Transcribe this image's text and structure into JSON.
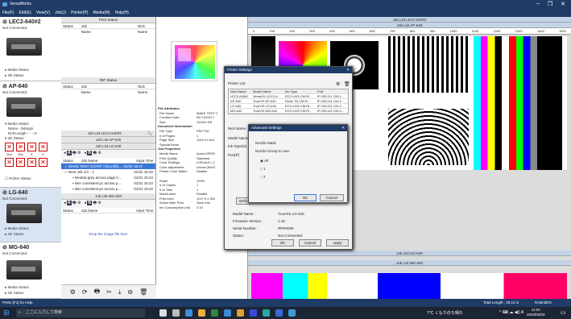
{
  "window": {
    "title": "VersaWorks",
    "min": "–",
    "max": "❐",
    "close": "✕"
  },
  "menu": [
    "File(F)",
    "Edit(E)",
    "View(V)",
    "Job(J)",
    "Printer(P)",
    "Media(M)",
    "Help(H)"
  ],
  "printers": [
    {
      "name": "LEC2-640#2",
      "status": "Not Connected.",
      "links": [
        "Media Status",
        "Ink Status"
      ]
    },
    {
      "name": "AP-640",
      "status": "Not Connected.",
      "links": [
        "Media Status",
        "Name - (Margin",
        "Roll Length - - - m",
        "Ink Status"
      ]
    },
    {
      "name": "LG-640",
      "status": "Not Connected.",
      "links": [
        "Media Status",
        "Ink Status"
      ]
    },
    {
      "name": "MG-640",
      "status": "Not Connected.",
      "links": [
        "Media Status",
        "Ink Status"
      ]
    }
  ],
  "ink_labels": [
    "Dot",
    "Dot",
    "K",
    "C"
  ],
  "printer_status": "Printer Status",
  "print_status": {
    "header": "Print Status",
    "cols": [
      "Status",
      "Job Name",
      "Nick Name"
    ]
  },
  "rip_status": {
    "header": "RIP Status",
    "cols": [
      "Status",
      "Job Name",
      "Nick Name"
    ]
  },
  "joblists": {
    "lec2": "Job List LEC2-640#2",
    "ap": "Job List AP-640",
    "lg": "Job List LG-640",
    "mg": "Job List MG-640",
    "ug": "Job List UG-640"
  },
  "queue": {
    "label": "A",
    "name": "B",
    "cols": [
      "Status",
      "Job Name",
      "Input Time"
    ],
    "jobs": [
      {
        "name": "MAKE TEST CHART rose.pdf(L...",
        "time": "01/31 15:47"
      },
      {
        "name": "Nest Job 1/1 - 1",
        "time": "01/31 15:22"
      },
      {
        "name": "Neutral grey across page.C...",
        "time": "01/31 15:22"
      },
      {
        "name": "skin consistency1 across p...",
        "time": "01/31 15:22"
      },
      {
        "name": "skin consistency2 across p...",
        "time": "01/31 15:22"
      }
    ]
  },
  "drop_text": "Drop the image file here",
  "attributes": [
    {
      "h": "File Attributes"
    },
    {
      "k": "File Name",
      "v": "MAKE TEST C"
    },
    {
      "k": "Creation Date",
      "v": "06/ 1/2023 1"
    },
    {
      "k": "Size",
      "v": "111494 KB"
    },
    {
      "h": "Document Information"
    },
    {
      "k": "File Type",
      "v": "PDF File"
    },
    {
      "k": "# of Pages",
      "v": "1"
    },
    {
      "k": "Page Size",
      "v": "1109.0 x 841"
    },
    {
      "k": "Special Items",
      "v": ""
    },
    {
      "h": "Job Properties"
    },
    {
      "k": "Media Name",
      "v": "Avery MPI50"
    },
    {
      "k": "Print Quality",
      "v": "Standard"
    },
    {
      "k": "Color Settings",
      "v": "LGEcoUV_C"
    },
    {
      "k": "Color Adjustment",
      "v": "Linear (Not E"
    },
    {
      "k": "Printer Color Match",
      "v": "Disable"
    },
    {
      "k": "",
      "v": ""
    },
    {
      "k": "Scale",
      "v": "100%"
    },
    {
      "k": "# of Copies",
      "v": "1"
    },
    {
      "k": "# of Tiles",
      "v": "1"
    },
    {
      "k": "Mark/Label",
      "v": "Disable"
    },
    {
      "k": "Print Area",
      "v": "1217.0 x 392"
    },
    {
      "k": "Action After Print",
      "v": "Save Job"
    },
    {
      "k": "Ink Consumption (ml)",
      "v": "2.10"
    }
  ],
  "ruler": [
    "0",
    "100",
    "200",
    "300",
    "400",
    "500",
    "600",
    "700",
    "800",
    "900",
    "1000",
    "1100",
    "1200",
    "1300",
    "1400",
    "1500"
  ],
  "printer_settings": {
    "title": "Printer Settings",
    "list_label": "Printer List",
    "cols": [
      "Nick Name",
      "Model Name",
      "Ink Type",
      "Port"
    ],
    "rows": [
      [
        "LEC2-640#2",
        "VersaUV LEC2-6...",
        "ECO-UV5 CMYK...",
        "IP:155.111.155.1..."
      ],
      [
        "AP-640",
        "TrueVIS AP-640",
        "Resin TA CMYK...",
        "IP:155.111.134.2..."
      ],
      [
        "LG-640",
        "TrueVIS LG-640",
        "ECO-UV5 CMYK...",
        "IP:155.111.134.2..."
      ],
      [
        "MG-640",
        "TrueVIS MG-640",
        "ECO-UV5 CMYK...",
        "IP:155.111.134.2..."
      ]
    ],
    "labels": [
      "Nick Name",
      "Model Name",
      "Ink Type(N)",
      "Port(P)"
    ],
    "verify": "Verify",
    "info": [
      [
        "Model Name :",
        "TrueVIS LG-640"
      ],
      [
        "Firmware Version :",
        "1.43"
      ],
      [
        "Serial Number :",
        "RPR0000"
      ],
      [
        "Status :",
        "Not Connected."
      ]
    ],
    "ok": "OK",
    "cancel": "Cancel",
    "apply": "Apply"
  },
  "advanced": {
    "title": "Advanced Settings",
    "mask": "Nozzle Mask",
    "group": "Nozzle Group to Use:",
    "options": [
      "All",
      "1",
      "2"
    ],
    "ok": "OK",
    "cancel": "Cancel"
  },
  "status_left": "Press [F1] for Help",
  "status_right": "Total Length : 39.13 in",
  "brand": "RolandDG",
  "search": "ここに入力して検索",
  "weather": "7°C  くもりのち晴れ",
  "clock_time": "11:02",
  "clock_date": "2023/02/03"
}
